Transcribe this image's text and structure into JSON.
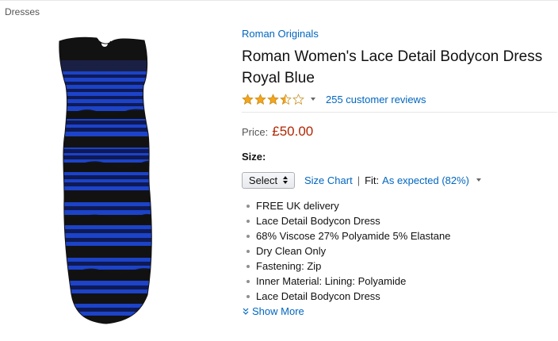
{
  "breadcrumb": {
    "label": "Dresses"
  },
  "product": {
    "brand": "Roman Originals",
    "title": "Roman Women's Lace Detail Bodycon Dress Royal Blue",
    "rating_value": 3.5,
    "rating_max": 5,
    "review_count_label": "255 customer reviews",
    "price_label": "Price:",
    "price_value": "£50.00",
    "image_icon": "dress-image"
  },
  "size": {
    "title": "Size:",
    "select_label": "Select",
    "size_chart_label": "Size Chart",
    "separator": "|",
    "fit_label": "Fit:",
    "fit_value": "As expected (82%)"
  },
  "features": [
    "FREE UK delivery",
    "Lace Detail Bodycon Dress",
    "68% Viscose 27% Polyamide 5% Elastane",
    "Dry Clean Only",
    "Fastening: Zip",
    "Inner Material: Lining: Polyamide",
    "Lace Detail Bodycon Dress"
  ],
  "show_more_label": "Show More",
  "colors": {
    "link": "#0066c0",
    "price": "#b12704",
    "star": "#f4a41d",
    "dress_blue": "#1c43c8",
    "dress_black": "#121212"
  }
}
